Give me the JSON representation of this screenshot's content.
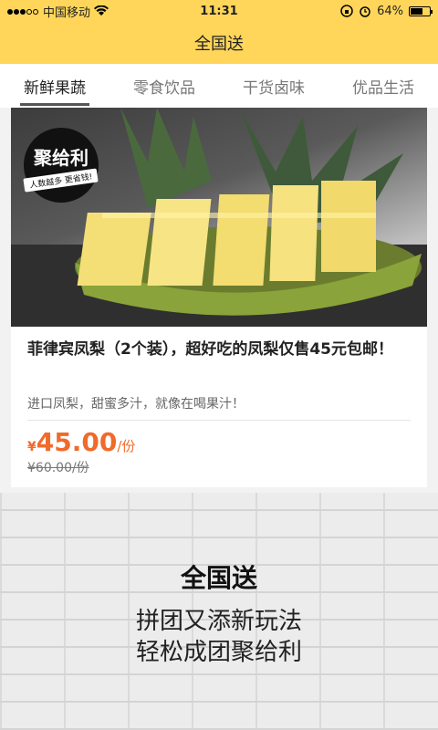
{
  "status_bar": {
    "carrier": "中国移动",
    "time": "11:31",
    "battery": "64%",
    "battery_level": 0.64,
    "icons": [
      "signal-dots-icon",
      "wifi-icon",
      "lock-rotation-icon",
      "alarm-icon",
      "battery-icon"
    ]
  },
  "navbar": {
    "title": "全国送"
  },
  "tabs": [
    {
      "label": "新鲜果蔬",
      "active": true
    },
    {
      "label": "零食饮品",
      "active": false
    },
    {
      "label": "干货卤味",
      "active": false
    },
    {
      "label": "优品生活",
      "active": false
    }
  ],
  "product": {
    "badge_title": "聚给利",
    "badge_sub": "人数越多 更省钱!",
    "title": "菲律宾凤梨（2个装），超好吃的凤梨仅售45元包邮！",
    "subtitle": "进口凤梨，甜蜜多汁，就像在喝果汁！",
    "price_symbol": "¥",
    "price": "45.00",
    "price_unit": "/份",
    "original_price": "¥60.00/份"
  },
  "promo": {
    "title": "全国送",
    "line1": "拼团又添新玩法",
    "line2": "轻松成团聚给利"
  },
  "colors": {
    "accent": "#ffd65a",
    "price": "#f06a2a"
  }
}
